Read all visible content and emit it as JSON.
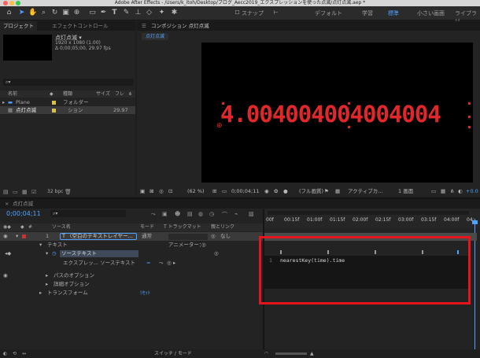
{
  "window": {
    "title": "Adobe After Effects - /Users/k_itoh/Desktop/ブログ_Aecc2019_エクスプレッションを使った点滅/点灯点滅.aep *"
  },
  "toolbar": {
    "snap_label": "スナップ",
    "workspaces": [
      "デフォルト",
      "学習",
      "標準",
      "小さい画面",
      "ライブラリ"
    ],
    "active_workspace": "標準"
  },
  "project": {
    "tab_label": "プロジェクト",
    "effects_tab": "エフェクトコントロール",
    "item_name": "点灯点滅 ▾",
    "item_info1": "1920 x 1080 (1.00)",
    "item_info2": "Δ 0;00;05;00, 29.97 fps",
    "search_placeholder": "⌕▾",
    "col_name": "名前",
    "col_type": "種類",
    "col_size": "サイズ",
    "col_frame": "フレ",
    "rows": [
      {
        "name": "Plane",
        "type": "フォルダー",
        "size": ""
      },
      {
        "name": "点灯点滅",
        "type": "ション",
        "size": "29.97"
      }
    ],
    "bpc": "32 bpc"
  },
  "composition": {
    "tab_label": "コンポジション 点灯点滅",
    "crumb": "点灯点滅",
    "display_text": "4.004004004004004",
    "zoom": "(62 %)",
    "timecode": "0;00;04;11",
    "resolution": "(フル画質)",
    "camera": "アクティブカ...",
    "views": "1 画面",
    "offset": "+0.0"
  },
  "timeline": {
    "tab_label": "点灯点滅",
    "timecode": "0;00;04;11",
    "col_source": "ソース名",
    "col_mode": "モード",
    "col_trkmat": "T トラックマット",
    "col_parent": "親とリンク",
    "layer_num": "1",
    "layer_name": "T 〈空白のテキストレイヤー...",
    "layer_mode": "通常",
    "layer_parent": "なし",
    "text_group": "テキスト",
    "animator": "アニメーター：",
    "source_text": "ソーステキスト",
    "expression_label": "エクスプレッ... ソーステキスト",
    "expression_eq": "=",
    "path_options": "パスのオプション",
    "more_options": "詳細オプション",
    "transform": "トランスフォーム",
    "reset": "ﾘｾｯﾄ",
    "ruler": [
      "00f",
      "00:15f",
      "01:00f",
      "01:15f",
      "02:00f",
      "02:15f",
      "03:00f",
      "03:15f",
      "04:00f",
      "04:"
    ],
    "code_line_number": "1",
    "code": "nearestKey(time).time",
    "bottom_label": "スイッチ / モード"
  },
  "colors": {
    "accent_blue": "#2d8ceb",
    "text_red": "#e0282c",
    "highlight_red": "#e8141c"
  }
}
